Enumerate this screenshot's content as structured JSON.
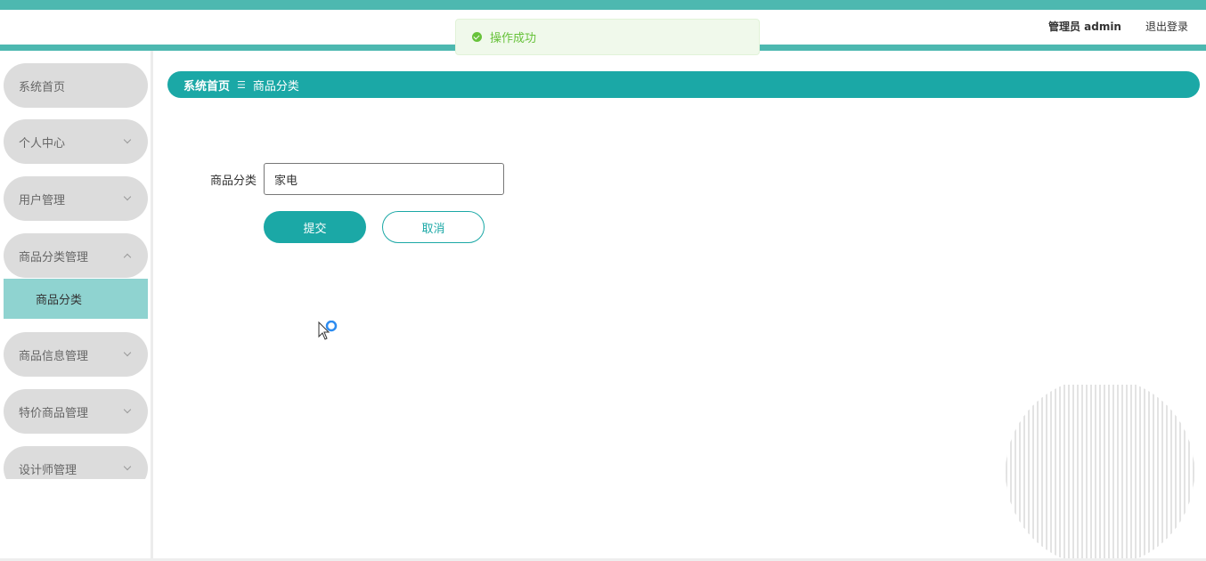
{
  "header": {
    "admin_label": "管理员 admin",
    "logout_label": "退出登录"
  },
  "toast": {
    "icon": "success-check-icon",
    "message": "操作成功",
    "color": "#67c23a"
  },
  "sidebar": {
    "items": [
      {
        "label": "系统首页",
        "expandable": false
      },
      {
        "label": "个人中心",
        "expandable": true,
        "expanded": false
      },
      {
        "label": "用户管理",
        "expandable": true,
        "expanded": false
      },
      {
        "label": "商品分类管理",
        "expandable": true,
        "expanded": true
      },
      {
        "label": "商品信息管理",
        "expandable": true,
        "expanded": false
      },
      {
        "label": "特价商品管理",
        "expandable": true,
        "expanded": false
      },
      {
        "label": "设计师管理",
        "expandable": true,
        "expanded": false
      }
    ],
    "active_submenu": {
      "label": "商品分类"
    }
  },
  "breadcrumb": {
    "home": "系统首页",
    "separator": "☰",
    "current": "商品分类"
  },
  "form": {
    "field_label": "商品分类",
    "field_value": "家电",
    "submit_label": "提交",
    "cancel_label": "取消"
  },
  "colors": {
    "accent": "#1ba8a6",
    "stripe": "#4db8b0",
    "submenu_active": "#8fd3d0",
    "menu_bg": "#dcdcdc"
  }
}
